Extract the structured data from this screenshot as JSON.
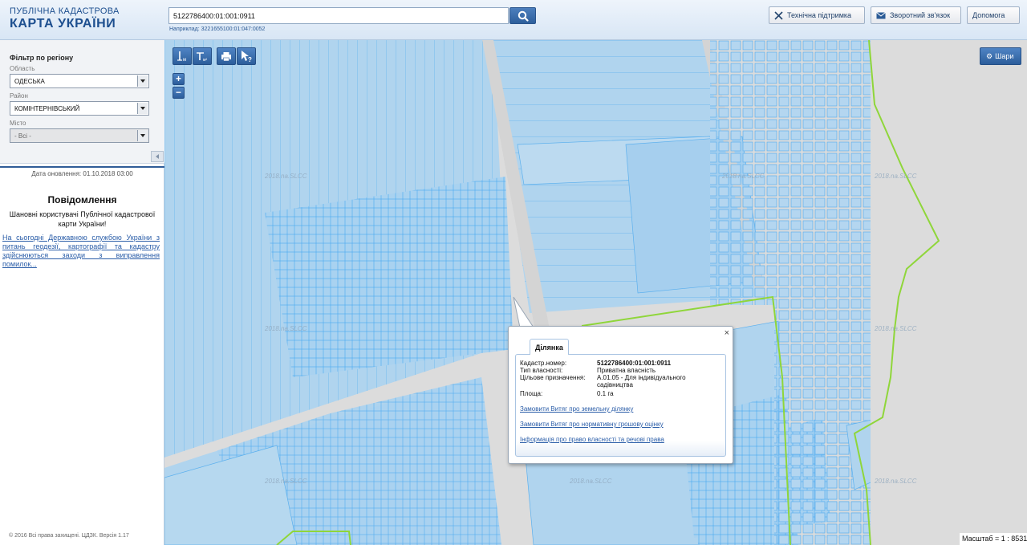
{
  "header": {
    "logo_line1": "Публічна кадастрова",
    "logo_line2": "Карта України",
    "search_value": "5122786400:01:001:0911",
    "search_hint": "Наприклад: 3221655100:01:047:0052",
    "btn_support": "Технічна підтримка",
    "btn_feedback": "Зворотний зв'язок",
    "btn_help": "Допомога"
  },
  "sidebar": {
    "filter_title": "Фільтр по регіону",
    "region_label": "Область",
    "region_value": "ОДЕСЬКА",
    "district_label": "Район",
    "district_value": "КОМІНТЕРНІВСЬКИЙ",
    "city_label": "Місто",
    "city_value": "- Всі -",
    "update_text": "Дата оновлення: 01.10.2018 03:00",
    "notice_title": "Повідомлення",
    "notice_text": "Шановні користувачі Публічної кадастрової карти України!",
    "notice_link": "На сьогодні Державною службою України з питань геодезії, картографії та кадастру здійснюються заходи з виправлення помилок...",
    "copyright": "© 2016 Всі права захищені. ЦДЗК. Версія 1.17"
  },
  "map": {
    "layers_label": "Шари",
    "zoom_in": "+",
    "zoom_out": "−",
    "scale_text": "Масштаб = 1 : 8531",
    "watermark": "2018.na.SLCC",
    "colors": {
      "parcel": "#b0d4ee",
      "parcel_stroke": "#5cb0ee",
      "boundary": "#8fd63a"
    }
  },
  "popup": {
    "tab": "Ділянка",
    "close": "×",
    "fields": [
      {
        "key": "Кадастр.номер:",
        "value": "5122786400:01:001:0911",
        "bold": true
      },
      {
        "key": "Тип власності:",
        "value": "Приватна власність"
      },
      {
        "key": "Цільове призначення:",
        "value": "А.01.05 - Для індивідуального садівництва"
      },
      {
        "key": "Площа:",
        "value": "0.1 га"
      }
    ],
    "link1": "Замовити Витяг про земельну ділянку",
    "link2": "Замовити Витяг про нормативну грошову оцінку",
    "link3": "Інформація про право власності та речові права"
  }
}
